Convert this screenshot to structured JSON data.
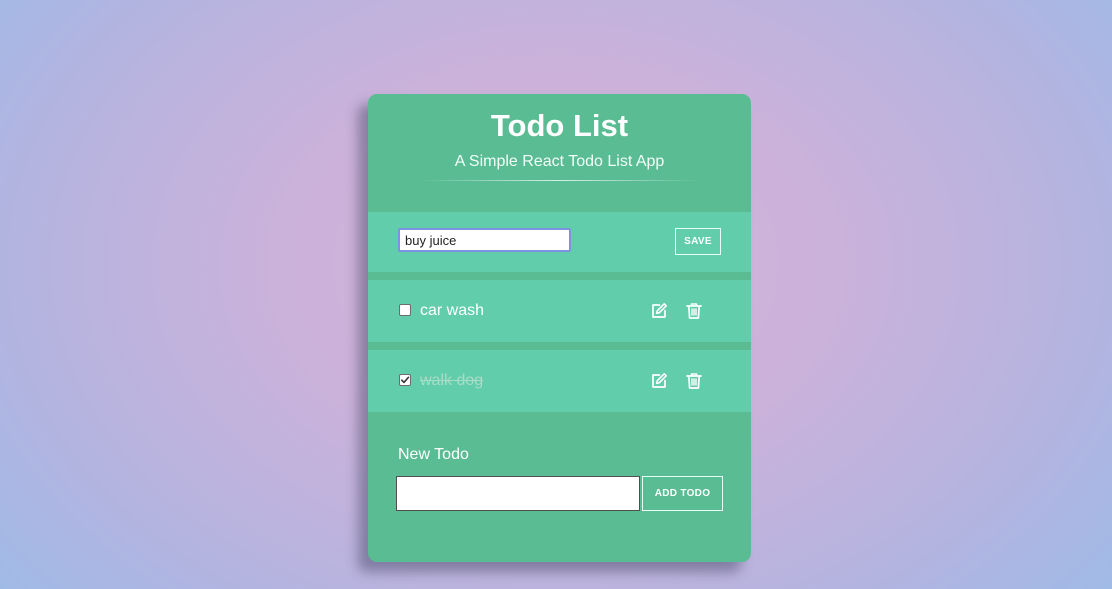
{
  "app": {
    "title": "Todo List",
    "subtitle": "A Simple React Todo List App"
  },
  "edit_form": {
    "value": "buy juice",
    "save_label": "SAVE"
  },
  "todos": [
    {
      "text": "car wash",
      "completed": false,
      "edit_icon": "edit-icon",
      "delete_icon": "trash-icon"
    },
    {
      "text": "walk dog",
      "completed": true,
      "edit_icon": "edit-icon",
      "delete_icon": "trash-icon"
    }
  ],
  "new_todo_form": {
    "label": "New Todo",
    "value": "",
    "placeholder": "",
    "button_label": "ADD TODO"
  },
  "colors": {
    "card": "#59bc92",
    "row": "#61cdab",
    "text": "#ffffff",
    "background_center": "#d4b2d7",
    "background_edge": "#99bce9"
  }
}
